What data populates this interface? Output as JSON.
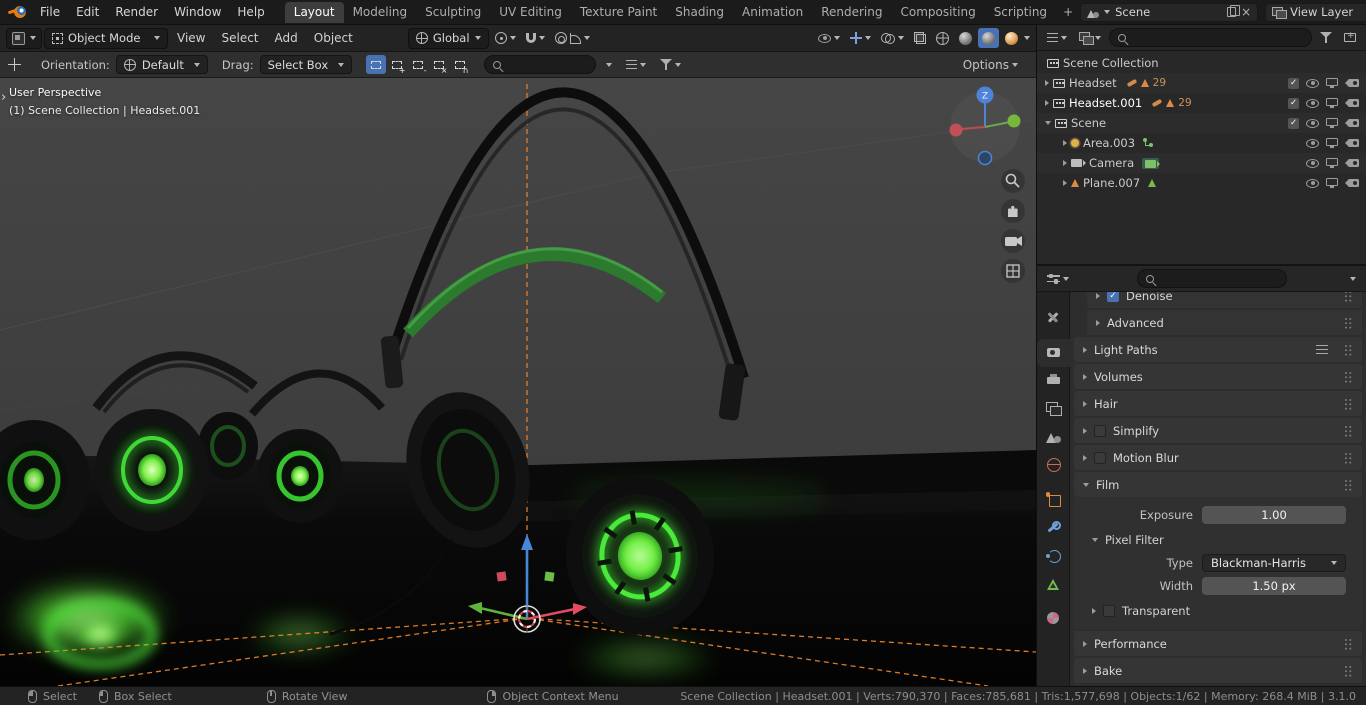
{
  "topbar": {
    "menus": [
      "File",
      "Edit",
      "Render",
      "Window",
      "Help"
    ],
    "workspaces": [
      "Layout",
      "Modeling",
      "Sculpting",
      "UV Editing",
      "Texture Paint",
      "Shading",
      "Animation",
      "Rendering",
      "Compositing",
      "Scripting"
    ],
    "add_workspace_label": "+",
    "scene_value": "Scene",
    "view_layer_value": "View Layer"
  },
  "viewport_header": {
    "mode_value": "Object Mode",
    "menus": [
      "View",
      "Select",
      "Add",
      "Object"
    ],
    "orientation_value": "Global"
  },
  "tool_settings": {
    "orientation_label": "Orientation:",
    "orientation_value": "Default",
    "drag_label": "Drag:",
    "drag_value": "Select Box",
    "options_label": "Options"
  },
  "viewport": {
    "view_label": "User Perspective",
    "context_label": "(1) Scene Collection | Headset.001",
    "axis_z": "Z"
  },
  "outliner": {
    "rows": [
      {
        "label": "Scene Collection"
      },
      {
        "label": "Headset",
        "badge": "29"
      },
      {
        "label": "Headset.001",
        "badge": "29"
      },
      {
        "label": "Scene"
      },
      {
        "label": "Area.003"
      },
      {
        "label": "Camera"
      },
      {
        "label": "Plane.007"
      }
    ]
  },
  "properties": {
    "panels": {
      "denoise": "Denoise",
      "advanced": "Advanced",
      "light_paths": "Light Paths",
      "volumes": "Volumes",
      "hair": "Hair",
      "simplify": "Simplify",
      "motion_blur": "Motion Blur",
      "film": "Film",
      "performance": "Performance",
      "bake": "Bake"
    },
    "film": {
      "exposure_label": "Exposure",
      "exposure_value": "1.00",
      "pixel_filter_label": "Pixel Filter",
      "type_label": "Type",
      "type_value": "Blackman-Harris",
      "width_label": "Width",
      "width_value": "1.50 px",
      "transparent_label": "Transparent"
    }
  },
  "statusbar": {
    "hints": [
      "Select",
      "Box Select",
      "Rotate View",
      "Object Context Menu"
    ],
    "stats": "Scene Collection | Headset.001 | Verts:790,370 | Faces:785,681 | Tris:1,577,698 | Objects:1/62 | Memory: 268.4 MiB | 3.1.0"
  },
  "colors": {
    "accent_blue": "#4772b3",
    "selection_orange": "#e77e24",
    "headset_glow_green": "#55f23c"
  }
}
